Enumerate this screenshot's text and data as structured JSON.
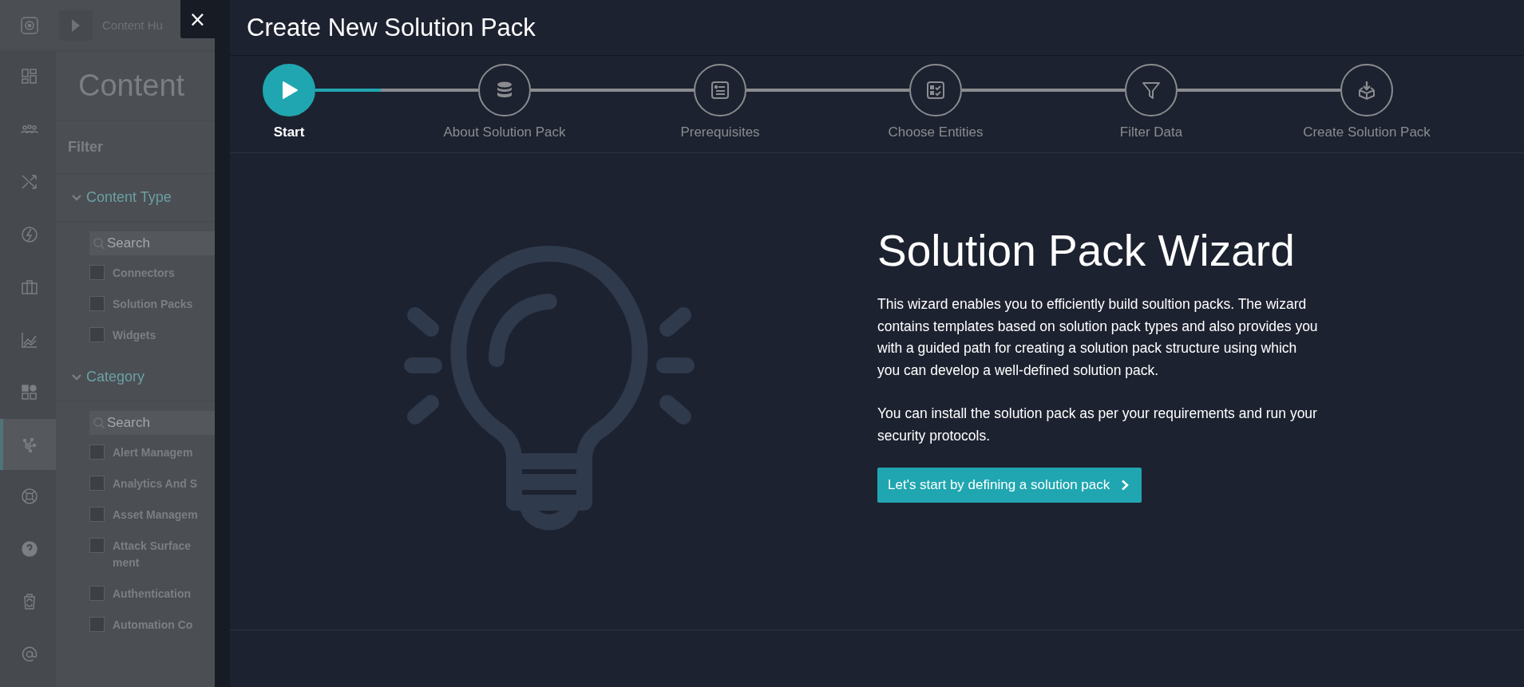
{
  "background_app": {
    "rail": [
      {
        "selected": false
      },
      {
        "selected": false
      },
      {
        "selected": false
      },
      {
        "selected": false
      },
      {
        "selected": false
      },
      {
        "selected": false
      },
      {
        "selected": false
      },
      {
        "selected": false
      },
      {
        "selected": true
      },
      {
        "selected": false
      },
      {
        "selected": false
      },
      {
        "selected": false
      },
      {
        "selected": false
      }
    ],
    "breadcrumb": "Content Hu",
    "page_title": "Content",
    "filter_title": "Filter",
    "sections": [
      {
        "title": "Content Type",
        "expanded": true,
        "search_placeholder": "Search",
        "items": [
          {
            "label": "Connectors",
            "checked": false
          },
          {
            "label": "Solution Packs",
            "checked": false
          },
          {
            "label": "Widgets",
            "checked": false
          }
        ]
      },
      {
        "title": "Category",
        "expanded": true,
        "search_placeholder": "Search",
        "items": [
          {
            "label": "Alert Managem",
            "checked": false
          },
          {
            "label": "Analytics And S",
            "checked": false
          },
          {
            "label": "Asset Managem",
            "checked": false
          },
          {
            "label": "Attack Surface\nment",
            "checked": false
          },
          {
            "label": "Authentication",
            "checked": false
          },
          {
            "label": "Automation Co",
            "checked": false
          }
        ]
      }
    ]
  },
  "close_button": "×",
  "dialog": {
    "title": "Create New Solution Pack",
    "steps": [
      {
        "label": "Start",
        "selected": true,
        "connector": {
          "level": 0.4
        }
      },
      {
        "label": "About Solution Pack",
        "selected": false
      },
      {
        "label": "Prerequisites",
        "selected": false
      },
      {
        "label": "Choose Entities",
        "selected": false
      },
      {
        "label": "Filter Data",
        "selected": false
      },
      {
        "label": "Create Solution Pack",
        "selected": false
      }
    ],
    "heading": "Solution Pack Wizard",
    "paragraphs": [
      "This wizard enables you to efficiently build soultion packs. The wizard contains templates based on solution pack types and also provides you with a guided path for creating a solution pack structure using which you can develop a well-defined solution pack.",
      "You can install the solution pack as per your requirements and run your security protocols."
    ],
    "start_button": "Let's start by defining a solution pack"
  }
}
